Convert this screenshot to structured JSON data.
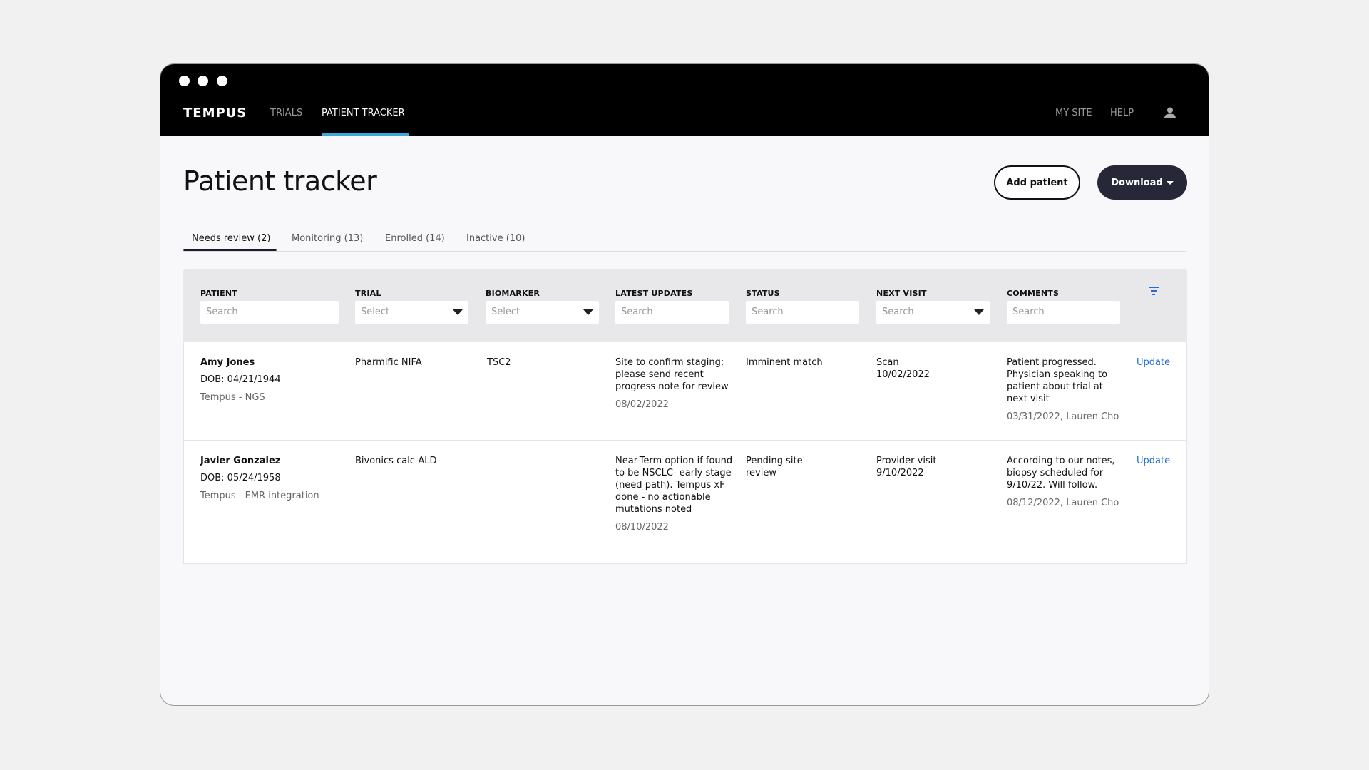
{
  "nav": {
    "logo": "TEMPUS",
    "items": [
      "TRIALS",
      "PATIENT TRACKER"
    ],
    "right": [
      "MY SITE",
      "HELP"
    ]
  },
  "page": {
    "title": "Patient tracker",
    "add_label": "Add patient",
    "download_label": "Download"
  },
  "tabs": [
    "Needs review (2)",
    "Monitoring (13)",
    "Enrolled (14)",
    "Inactive (10)"
  ],
  "columns": [
    "PATIENT",
    "TRIAL",
    "BIOMARKER",
    "LATEST UPDATES",
    "STATUS",
    "NEXT VISIT",
    "COMMENTS"
  ],
  "filters": [
    "Search",
    "Select",
    "Select",
    "Search",
    "Search",
    "Search",
    "Search"
  ],
  "rows": [
    {
      "name": "Amy Jones",
      "dob": "DOB: 04/21/1944",
      "source": "Tempus - NGS",
      "trial": "Pharmific NIFA",
      "biomarker": "TSC2",
      "update": "Site to confirm staging; please send recent progress note for review",
      "update_date": "08/02/2022",
      "status": "Imminent match",
      "visit": "Scan",
      "visit_date": "10/02/2022",
      "comment": "Patient progressed. Physician speaking to patient about trial at next visit",
      "comment_meta": "03/31/2022, Lauren Cho",
      "action": "Update"
    },
    {
      "name": "Javier Gonzalez",
      "dob": "DOB: 05/24/1958",
      "source": "Tempus - EMR integration",
      "trial": "Bivonics calc-ALD",
      "biomarker": "",
      "update": "Near-Term option if found to be NSCLC- early stage (need path). Tempus xF done - no actionable mutations noted",
      "update_date": "08/10/2022",
      "status": "Pending site review",
      "visit": "Provider visit",
      "visit_date": "9/10/2022",
      "comment": "According to our notes, biopsy scheduled for 9/10/22. Will follow.",
      "comment_meta": "08/12/2022, Lauren Cho",
      "action": "Update"
    }
  ],
  "colors": {
    "accent": "#3aa8d8",
    "link": "#1f6fd1",
    "primary": "#262838"
  }
}
